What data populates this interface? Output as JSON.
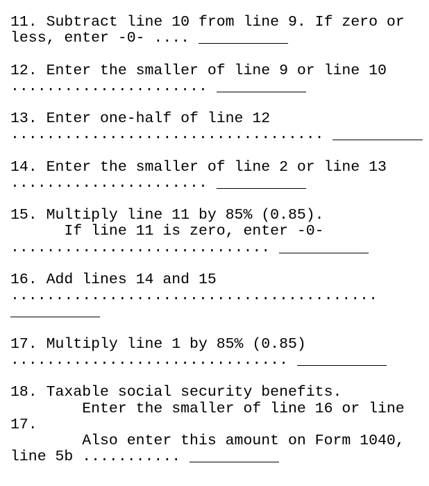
{
  "lines": [
    {
      "text": "11. Subtract line 10 from line 9. If zero or"
    },
    {
      "text": "less, enter -0- .... ",
      "blank": true
    },
    {
      "text": ""
    },
    {
      "text": "12. Enter the smaller of line 9 or line 10"
    },
    {
      "text": "...................... ",
      "blank": true
    },
    {
      "text": ""
    },
    {
      "text": "13. Enter one-half of line 12"
    },
    {
      "text": "................................... ",
      "blank": true
    },
    {
      "text": ""
    },
    {
      "text": "14. Enter the smaller of line 2 or line 13"
    },
    {
      "text": "...................... ",
      "blank": true
    },
    {
      "text": ""
    },
    {
      "text": "15. Multiply line 11 by 85% (0.85)."
    },
    {
      "text": "      If line 11 is zero, enter -0-"
    },
    {
      "text": "............................. ",
      "blank": true
    },
    {
      "text": ""
    },
    {
      "text": "16. Add lines 14 and 15"
    },
    {
      "text": "........................................."
    },
    {
      "text": "",
      "blank": true
    },
    {
      "text": ""
    },
    {
      "text": "17. Multiply line 1 by 85% (0.85)"
    },
    {
      "text": "............................... ",
      "blank": true
    },
    {
      "text": ""
    },
    {
      "text": "18. Taxable social security benefits."
    },
    {
      "text": "        Enter the smaller of line 16 or line"
    },
    {
      "text": "17."
    },
    {
      "text": "        Also enter this amount on Form 1040,"
    },
    {
      "text": "line 5b ........... ",
      "blank": true
    }
  ]
}
